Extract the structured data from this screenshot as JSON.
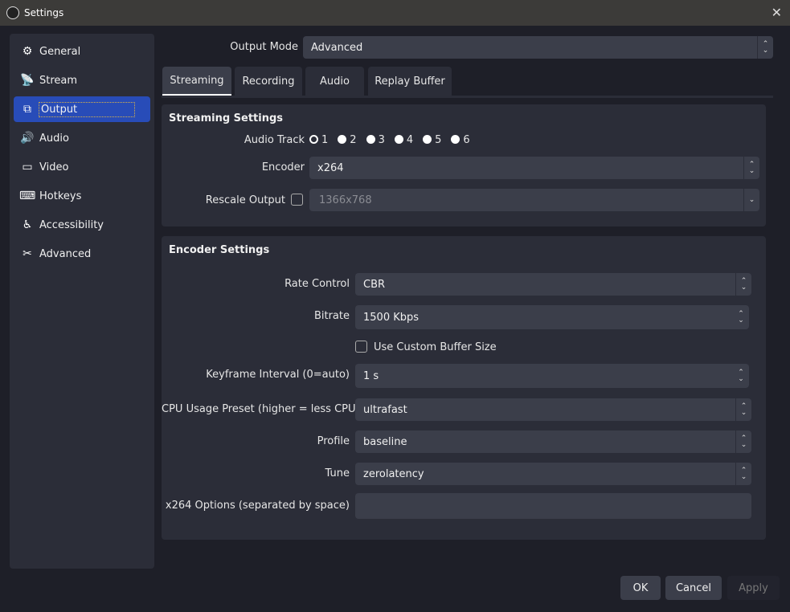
{
  "window": {
    "title": "Settings"
  },
  "sidebar": {
    "items": [
      {
        "label": "General",
        "icon": "gear-icon",
        "glyph": "⚙"
      },
      {
        "label": "Stream",
        "icon": "antenna-icon",
        "glyph": "📡"
      },
      {
        "label": "Output",
        "icon": "output-icon",
        "glyph": "⧉",
        "selected": true
      },
      {
        "label": "Audio",
        "icon": "speaker-icon",
        "glyph": "🔊"
      },
      {
        "label": "Video",
        "icon": "monitor-icon",
        "glyph": "▭"
      },
      {
        "label": "Hotkeys",
        "icon": "keyboard-icon",
        "glyph": "⌨"
      },
      {
        "label": "Accessibility",
        "icon": "accessibility-icon",
        "glyph": "♿"
      },
      {
        "label": "Advanced",
        "icon": "tools-icon",
        "glyph": "✂"
      }
    ]
  },
  "output_mode": {
    "label": "Output Mode",
    "value": "Advanced"
  },
  "tabs": [
    {
      "label": "Streaming",
      "active": true
    },
    {
      "label": "Recording"
    },
    {
      "label": "Audio"
    },
    {
      "label": "Replay Buffer"
    }
  ],
  "streaming": {
    "title": "Streaming Settings",
    "audio_track_label": "Audio Track",
    "tracks": [
      "1",
      "2",
      "3",
      "4",
      "5",
      "6"
    ],
    "selected_track": "1",
    "encoder_label": "Encoder",
    "encoder": "x264",
    "rescale_label": "Rescale Output",
    "rescale_checked": false,
    "rescale_value": "1366x768"
  },
  "encoder": {
    "title": "Encoder Settings",
    "rate_control_label": "Rate Control",
    "rate_control": "CBR",
    "bitrate_label": "Bitrate",
    "bitrate": "1500 Kbps",
    "custom_buffer_label": "Use Custom Buffer Size",
    "custom_buffer_checked": false,
    "keyframe_label": "Keyframe Interval (0=auto)",
    "keyframe": "1 s",
    "cpu_label": "CPU Usage Preset (higher = less CPU)",
    "cpu": "ultrafast",
    "profile_label": "Profile",
    "profile": "baseline",
    "tune_label": "Tune",
    "tune": "zerolatency",
    "options_label": "x264 Options (separated by space)",
    "options": ""
  },
  "buttons": {
    "ok": "OK",
    "cancel": "Cancel",
    "apply": "Apply"
  },
  "colors": {
    "accent": "#284cb8",
    "background": "#1e1f28",
    "panel": "#2b2d38",
    "input": "#3b3e4a"
  }
}
